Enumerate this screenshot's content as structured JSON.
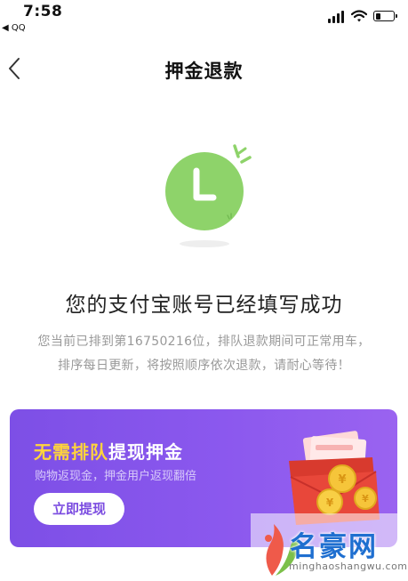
{
  "status_bar": {
    "time": "7:58",
    "back_app": "◀ QQ"
  },
  "navbar": {
    "title": "押金退款"
  },
  "message": {
    "title": "您的支付宝账号已经填写成功",
    "line1": "您当前已排到第16750216位，排队退款期间可正常用车，",
    "line2": "排序每日更新，将按照顺序依次退款，请耐心等待！"
  },
  "promo": {
    "title_highlight": "无需排队",
    "title_rest": "提现押金",
    "subtitle": "购物返现金，押金用户返现翻倍",
    "button_label": "立即提现"
  },
  "watermark": {
    "text": "名豪网",
    "url": "minghaoshangwu.com"
  },
  "colors": {
    "accent_green": "#8ed36a",
    "promo_purple": "#8b58ee",
    "highlight_yellow": "#ffd43b"
  }
}
